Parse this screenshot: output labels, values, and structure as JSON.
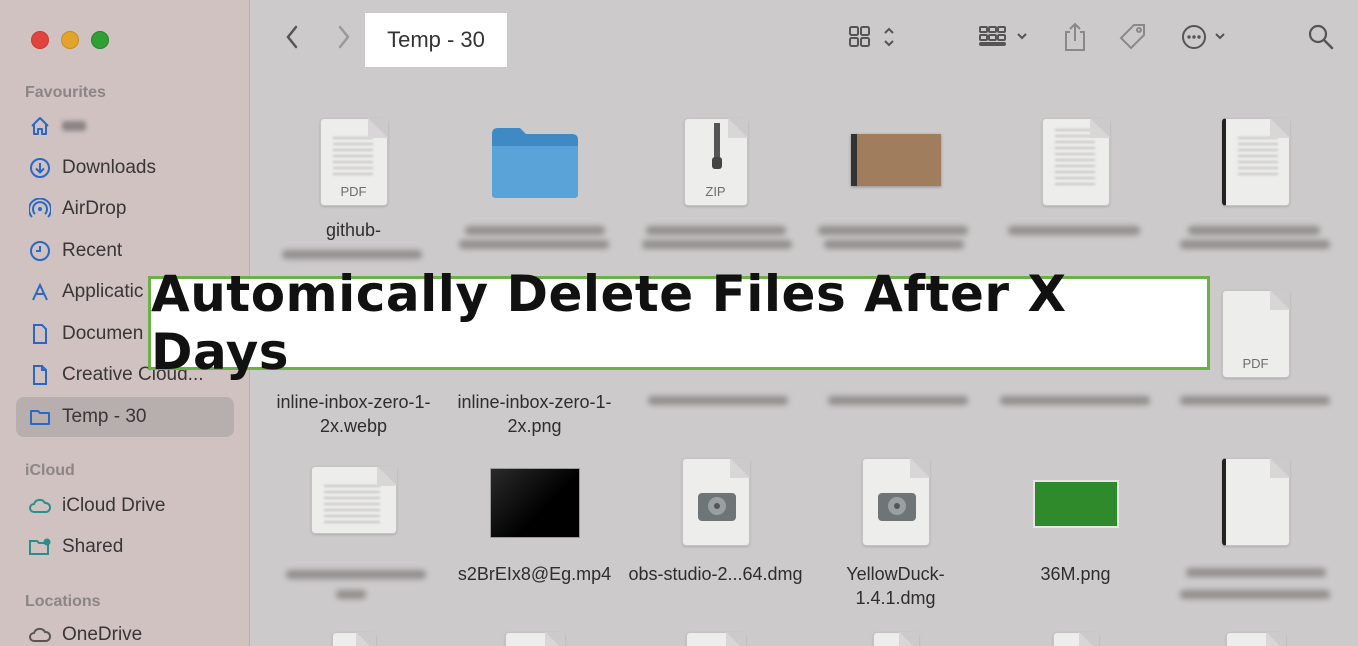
{
  "window": {
    "title": "Temp - 30"
  },
  "sidebar": {
    "favourites_title": "Favourites",
    "favourites": [
      {
        "label": "",
        "icon": "home-icon"
      },
      {
        "label": "Downloads",
        "icon": "download-icon"
      },
      {
        "label": "AirDrop",
        "icon": "airdrop-icon"
      },
      {
        "label": "Recent",
        "icon": "clock-icon"
      },
      {
        "label": "Applicatic",
        "icon": "applications-icon"
      },
      {
        "label": "Documen",
        "icon": "document-icon"
      },
      {
        "label": "Creative Cloud...",
        "icon": "file-icon"
      },
      {
        "label": "Temp - 30",
        "icon": "folder-icon",
        "active": true
      }
    ],
    "icloud_title": "iCloud",
    "icloud": [
      {
        "label": "iCloud Drive",
        "icon": "cloud-icon"
      },
      {
        "label": "Shared",
        "icon": "shared-folder-icon"
      }
    ],
    "locations_title": "Locations",
    "locations": [
      {
        "label": "OneDrive",
        "icon": "cloud-icon"
      }
    ]
  },
  "toolbar": {
    "back_icon": "chevron-left-icon",
    "forward_icon": "chevron-right-icon",
    "view_icon": "grid-view-icon",
    "group_icon": "group-icon",
    "share_icon": "share-icon",
    "tag_icon": "tag-icon",
    "more_icon": "ellipsis-circle-icon",
    "search_icon": "search-icon"
  },
  "files": {
    "row1": [
      {
        "name": "github-",
        "kind": "PDF"
      },
      {
        "name": "",
        "kind": "folder"
      },
      {
        "name": "",
        "kind": "ZIP"
      },
      {
        "name": "",
        "kind": "image"
      },
      {
        "name": "",
        "kind": "document"
      },
      {
        "name": "",
        "kind": "document"
      }
    ],
    "row2": [
      {
        "name": "inline-inbox-zero-1-2x.webp"
      },
      {
        "name": "inline-inbox-zero-1-2x.png"
      },
      {
        "name": ""
      },
      {
        "name": ""
      },
      {
        "name": ""
      },
      {
        "name": "",
        "kind": "PDF"
      }
    ],
    "row3": [
      {
        "name": "",
        "kind": "document"
      },
      {
        "name": "s2BrEIx8@Eg.mp4",
        "kind": "video"
      },
      {
        "name": "obs-studio-2...64.dmg",
        "kind": "dmg"
      },
      {
        "name": "YellowDuck-1.4.1.dmg",
        "kind": "dmg"
      },
      {
        "name": "36M.png",
        "kind": "image"
      },
      {
        "name": "",
        "kind": "document"
      }
    ]
  },
  "banner": {
    "text": "Automically Delete Files After X Days"
  },
  "colors": {
    "accent": "#2a68c8",
    "banner_border": "#6ab247",
    "sidebar_bg": "#cfc2c1"
  }
}
